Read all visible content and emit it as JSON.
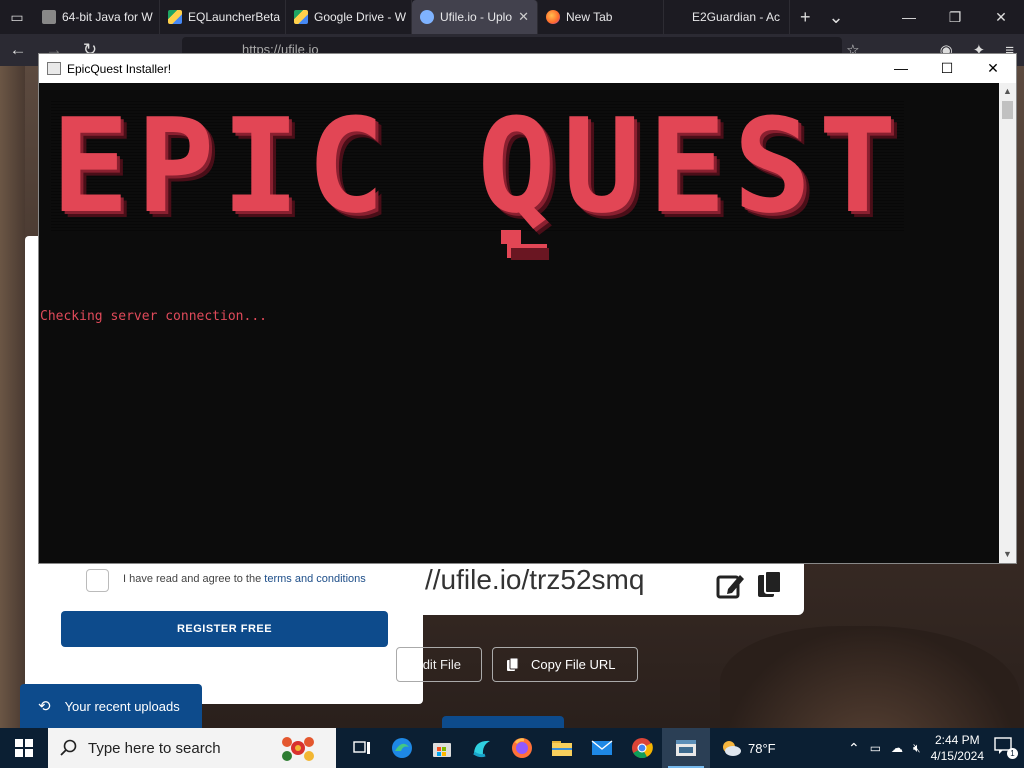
{
  "browser": {
    "tabs": [
      {
        "label": "64-bit Java for W",
        "icon": "java-page-icon",
        "active": false
      },
      {
        "label": "EQLauncherBeta",
        "icon": "google-drive-icon",
        "active": false
      },
      {
        "label": "Google Drive - W",
        "icon": "google-drive-icon",
        "active": false
      },
      {
        "label": "Ufile.io - Uplo",
        "icon": "ufile-icon",
        "active": true
      },
      {
        "label": "New Tab",
        "icon": "firefox-icon",
        "active": false
      },
      {
        "label": "E2Guardian - Ac",
        "icon": "blank-page-icon",
        "active": false
      }
    ],
    "tab_close": "✕",
    "new_tab": "+",
    "tab_list": "⌄",
    "url": "https://ufile.io",
    "window_controls": {
      "minimize": "—",
      "maximize": "❐",
      "close": "✕"
    }
  },
  "page": {
    "terms_prefix": "I have read and agree to the ",
    "terms_link": "terms and conditions",
    "register_label": "REGISTER FREE",
    "file_url": "//ufile.io/trz52smq",
    "edit_file_label": "dit File",
    "copy_url_label": "Copy File URL",
    "recent_uploads_label": "Your recent uploads"
  },
  "installer": {
    "title": "EpicQuest Installer!",
    "banner": "EPIC QUEST",
    "console_line": "Checking server connection...",
    "controls": {
      "minimize": "—",
      "maximize": "☐",
      "close": "✕"
    },
    "accent_color": "#e24655"
  },
  "taskbar": {
    "search_placeholder": "Type here to search",
    "weather": "78°F",
    "time": "2:44 PM",
    "date": "4/15/2024",
    "notification_count": "1",
    "apps": [
      "task-view-icon",
      "edge-icon",
      "store-icon",
      "terminal-icon",
      "firefox-icon",
      "file-explorer-icon",
      "mail-icon",
      "chrome-icon",
      "java-app-icon"
    ]
  }
}
